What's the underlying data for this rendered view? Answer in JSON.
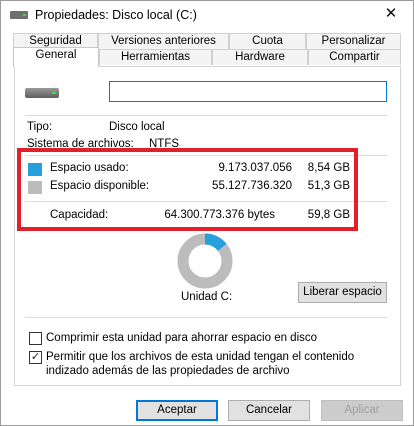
{
  "window": {
    "title": "Propiedades: Disco local (C:)",
    "close_glyph": "✕"
  },
  "tabs_row1": [
    "Seguridad",
    "Versiones anteriores",
    "Cuota",
    "Personalizar"
  ],
  "tabs_row2": [
    "General",
    "Hardware",
    "Herramientas",
    "Compartir"
  ],
  "active_tab": "General",
  "general": {
    "name_value": "",
    "type_label": "Tipo:",
    "type_value": "Disco local",
    "fs_label": "Sistema de archivos:",
    "fs_value": "NTFS"
  },
  "space": {
    "used_label": "Espacio usado:",
    "used_bytes": "9.173.037.056",
    "used_gb": "8,54 GB",
    "free_label": "Espacio disponible:",
    "free_bytes": "55.127.736.320",
    "free_gb": "51,3 GB",
    "capacity_label": "Capacidad:",
    "capacity_bytes": "64.300.773.376 bytes",
    "capacity_gb": "59,8 GB",
    "used_color": "#26a0da",
    "free_color": "#bcbcbc",
    "used_fraction": 0.1427
  },
  "drive_label": "Unidad C:",
  "cleanup_button": "Liberar espacio",
  "options": {
    "compress_label": "Comprimir esta unidad para ahorrar espacio en disco",
    "compress_checked": false,
    "index_label_line1": "Permitir que los archivos de esta unidad tengan el contenido",
    "index_label_line2": "indizado además de las propiedades de archivo",
    "index_checked": true,
    "check_glyph": "✓"
  },
  "buttons": {
    "ok": "Aceptar",
    "cancel": "Cancelar",
    "apply": "Aplicar"
  },
  "highlight_color": "#e0212b"
}
